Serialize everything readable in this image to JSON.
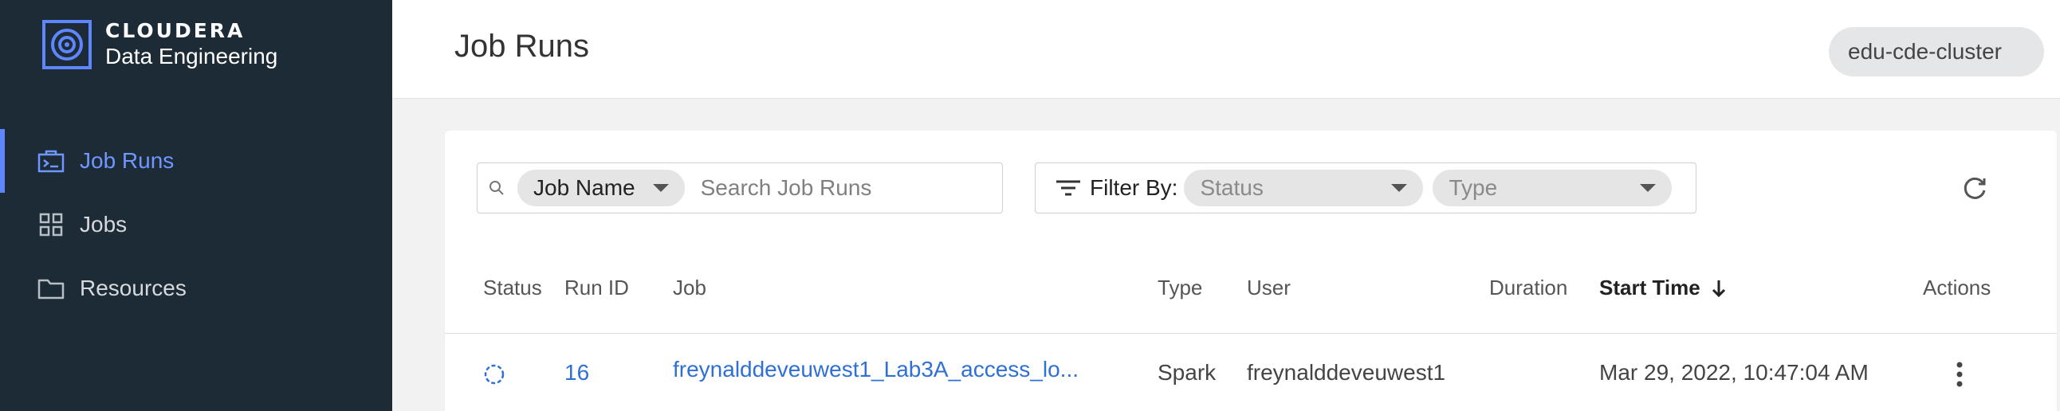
{
  "brand": {
    "name": "CLOUDERA",
    "subtitle": "Data Engineering"
  },
  "sidebar": {
    "items": [
      {
        "label": "Job Runs",
        "icon": "job-runs-icon",
        "active": true
      },
      {
        "label": "Jobs",
        "icon": "grid-icon",
        "active": false
      },
      {
        "label": "Resources",
        "icon": "folder-icon",
        "active": false
      }
    ]
  },
  "header": {
    "title": "Job Runs",
    "cluster": "edu-cde-cluster"
  },
  "search": {
    "filter_field": "Job Name",
    "placeholder": "Search Job Runs"
  },
  "filter": {
    "label": "Filter By:",
    "status_placeholder": "Status",
    "type_placeholder": "Type"
  },
  "table": {
    "columns": [
      "Status",
      "Run ID",
      "Job",
      "Type",
      "User",
      "Duration",
      "Start Time",
      "Actions"
    ],
    "sorted_column": "Start Time",
    "sort_direction": "descending",
    "rows": [
      {
        "status": "running",
        "run_id": "16",
        "job": "freynalddeveuwest1_Lab3A_access_lo...",
        "type": "Spark",
        "user": "freynalddeveuwest1",
        "duration": "",
        "start_time": "Mar 29, 2022, 10:47:04 AM"
      }
    ]
  },
  "colors": {
    "sidebar_bg": "#1c2b36",
    "accent": "#5d86ff",
    "link": "#2f6fd6"
  }
}
